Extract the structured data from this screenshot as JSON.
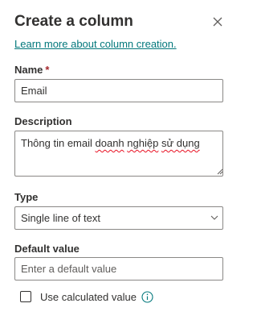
{
  "panel": {
    "title": "Create a column",
    "learn_more_link": "Learn more about column creation."
  },
  "name_field": {
    "label": "Name",
    "required_marker": "*",
    "value": "Email"
  },
  "description_field": {
    "label": "Description",
    "value_plain": "Thông tin email ",
    "value_misspelled_1": "doanh",
    "value_space_1": " ",
    "value_misspelled_2": "nghiệp",
    "value_space_2": " ",
    "value_misspelled_3": "sử dụng"
  },
  "type_field": {
    "label": "Type",
    "selected": "Single line of text"
  },
  "default_value_field": {
    "label": "Default value",
    "placeholder": "Enter a default value"
  },
  "calculated_value": {
    "label": "Use calculated value",
    "checked": false
  },
  "icons": {
    "close": "close-icon",
    "chevron": "chevron-down-icon",
    "info": "info-icon",
    "resize": "resize-grip-icon"
  },
  "colors": {
    "link": "#03787c",
    "required": "#a4262c",
    "info_icon": "#03787c",
    "border": "#8a8886",
    "spellcheck": "#e81123"
  }
}
